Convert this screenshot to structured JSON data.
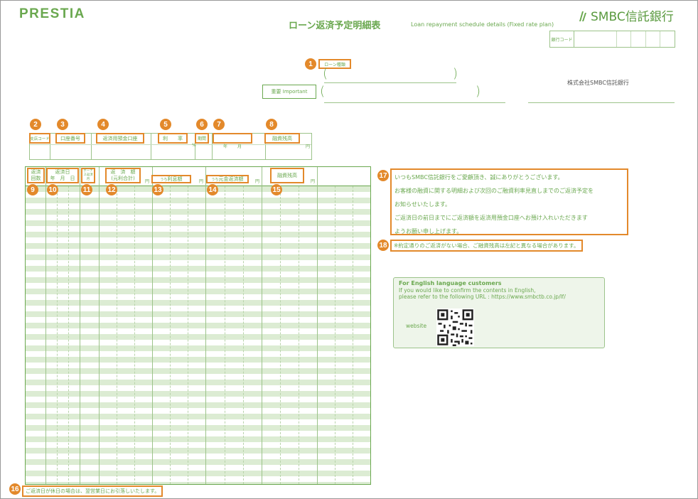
{
  "header": {
    "brand_left": "PRESTIA",
    "brand_right": "SMBC信託銀行",
    "title_jp": "ローン返済予定明細表",
    "title_en": "Loan repayment schedule details (Fixed rate plan)",
    "bank_code_label": "銀行コード"
  },
  "top_fields": {
    "loan_type_label": "ローン種類",
    "important_label": "重要 Important",
    "company_name": "株式会社SMBC信託銀行"
  },
  "info_row": {
    "branch_code": "支店コード",
    "account_number": "口座番号",
    "repayment_account": "返済用預金口座",
    "interest_rate": "利　　率",
    "period": "期間",
    "loan_balance": "融資残高",
    "rate_unit": "%",
    "year_unit": "年",
    "month_unit": "月",
    "yen_unit": "円"
  },
  "table": {
    "col_count_line1": "返済",
    "col_count_line2": "回数",
    "col_date_line1": "返済日",
    "col_date_year": "年",
    "col_date_month": "月",
    "col_date_day": "日",
    "col_bonus": "ボーナス返済月",
    "col_amount_line1": "返　済　額",
    "col_amount_line2": "(元利合計)",
    "col_interest_prefix": "うち",
    "col_interest": "利息額",
    "col_principal_prefix": "うち",
    "col_principal": "元金返済額",
    "col_balance": "融資残高",
    "yen": "円"
  },
  "badges": [
    "1",
    "2",
    "3",
    "4",
    "5",
    "6",
    "7",
    "8",
    "9",
    "10",
    "11",
    "12",
    "13",
    "14",
    "15",
    "16",
    "17",
    "18"
  ],
  "message": {
    "lines": [
      "いつもSMBC信託銀行をご愛顧頂き、誠にありがとうございます。",
      "お客様の融資に関する明細および次回のご融資利率見直しまでのご返済予定を",
      "お知らせいたします。",
      "ご返済日の前日までにご返済額を返済用預金口座へお預け入れいただきます",
      "ようお願い申し上げます。"
    ],
    "note": "※約定通りのご返済がない場合、ご融資残高は左記と異なる場合があります。"
  },
  "english": {
    "heading": "For English language customers",
    "line1": "If you would like to confirm the contents in English,",
    "line2": "please refer to the following URL : https://www.smbctb.co.jp/lf/",
    "website_label": "website"
  },
  "footer": {
    "holiday_note": "ご返済日が休日の場合は、翌営業日にお引落しいたします。"
  },
  "colors": {
    "brand_green": "#6aa84f",
    "badge_orange": "#e3892b",
    "stripe": "#dcecd3"
  }
}
